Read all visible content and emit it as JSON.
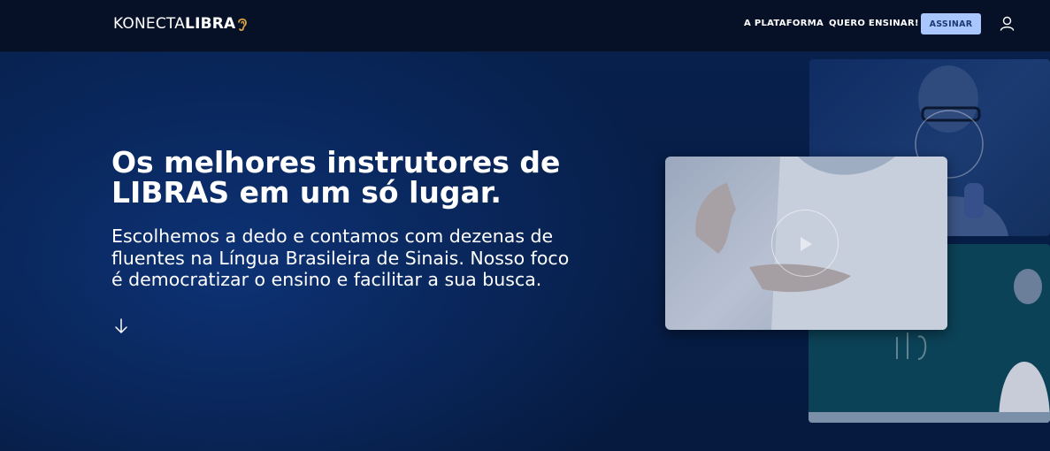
{
  "header": {
    "logo": {
      "part1": "KONECTA",
      "part2": "LIBRA"
    },
    "nav": {
      "platform": "A PLATAFORMA",
      "teach": "QUERO ENSINAR!",
      "subscribe": "ASSINAR"
    },
    "icons": {
      "user": "user-icon",
      "logo_ear": "ear-icon"
    }
  },
  "hero": {
    "title": "Os melhores instrutores de LIBRAS em um só lugar.",
    "text": "Escolhemos a dedo e contamos com dezenas de fluentes na Língua Brasileira de Sinais. Nosso foco é democratizar o ensino e facilitar a sua busca.",
    "arrow_icon": "arrow-down-icon"
  },
  "colors": {
    "navbar_bg": "#061127",
    "hero_bg": "#061a3f",
    "accent_button": "#a9c6ff",
    "accent_text": "#1e3a73"
  }
}
